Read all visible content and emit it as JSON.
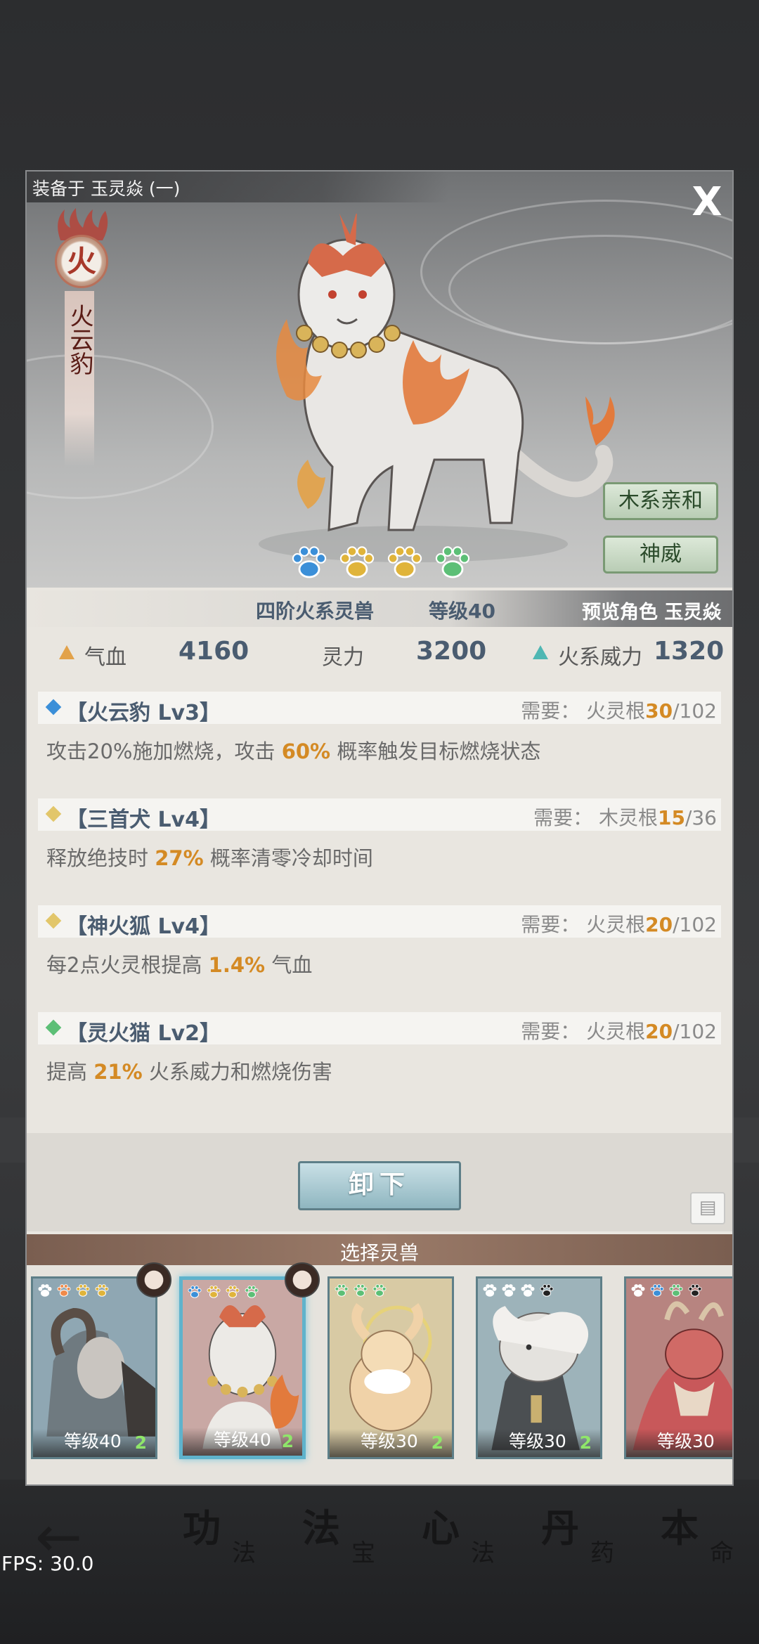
{
  "equip_label": "装备于 玉灵焱 (一)",
  "close_label": "X",
  "element_char": "火",
  "beast_name": "火云豹",
  "tags": [
    "木系亲和",
    "神威"
  ],
  "paw_colors": [
    "#3b8fd8",
    "#e0b43a",
    "#e0b43a",
    "#5cbf76"
  ],
  "info": {
    "rank": "四阶火系灵兽",
    "level": "等级40",
    "preview": "预览角色 玉灵焱"
  },
  "stats": [
    {
      "label": "气血",
      "value": "4160"
    },
    {
      "label": "灵力",
      "value": "3200"
    },
    {
      "label": "火系威力",
      "value": "1320"
    }
  ],
  "skills": [
    {
      "name": "【火云豹 Lv3】",
      "diamond": "#3b8fd8",
      "req_prefix": "需要：  火灵根",
      "req_have": "30",
      "req_total": "/102",
      "desc_before": "攻击20%施加燃烧，攻击 ",
      "desc_hl": "60%",
      "desc_after": " 概率触发目标燃烧状态"
    },
    {
      "name": "【三首犬 Lv4】",
      "diamond": "#e2c66a",
      "req_prefix": "需要：  木灵根",
      "req_have": "15",
      "req_total": "/36",
      "desc_before": "释放绝技时 ",
      "desc_hl": "27%",
      "desc_after": " 概率清零冷却时间"
    },
    {
      "name": "【神火狐 Lv4】",
      "diamond": "#e2c66a",
      "req_prefix": "需要：  火灵根",
      "req_have": "20",
      "req_total": "/102",
      "desc_before": "每2点火灵根提高 ",
      "desc_hl": "1.4%",
      "desc_after": " 气血"
    },
    {
      "name": "【灵火猫 Lv2】",
      "diamond": "#5cbf76",
      "req_prefix": "需要：  火灵根",
      "req_have": "20",
      "req_total": "/102",
      "desc_before": "提高 ",
      "desc_hl": "21%",
      "desc_after": " 火系威力和燃烧伤害"
    }
  ],
  "unequip_label": "卸下",
  "select_title": "选择灵兽",
  "cards": [
    {
      "level": "等级40",
      "stars": "2",
      "art": "ram",
      "paws": [
        "#ffffff",
        "#f08a4a",
        "#e0b43a",
        "#e0b43a"
      ],
      "has_avatar": true
    },
    {
      "level": "等级40",
      "stars": "2",
      "art": "leopard",
      "selected": true,
      "paws": [
        "#3b8fd8",
        "#e0b43a",
        "#e0b43a",
        "#5cbf76"
      ],
      "has_avatar": true
    },
    {
      "level": "等级30",
      "stars": "2",
      "art": "rabbit",
      "paws": [
        "#5cbf76",
        "#5cbf76",
        "#5cbf76"
      ],
      "has_avatar": false
    },
    {
      "level": "等级30",
      "stars": "2",
      "art": "lion",
      "paws": [
        "#ffffff",
        "#ffffff",
        "#ffffff",
        "#222222"
      ],
      "has_avatar": false
    },
    {
      "level": "等级30",
      "stars": "",
      "art": "dragon",
      "paws": [
        "#ffffff",
        "#3b8fd8",
        "#5cbf76",
        "#222222"
      ],
      "has_avatar": false
    }
  ],
  "background_nav": [
    {
      "big": "功",
      "small": "法"
    },
    {
      "big": "法",
      "small": "宝"
    },
    {
      "big": "心",
      "small": "法"
    },
    {
      "big": "丹",
      "small": "药"
    },
    {
      "big": "本",
      "small": "命"
    }
  ],
  "fps": "FPS: 30.0"
}
